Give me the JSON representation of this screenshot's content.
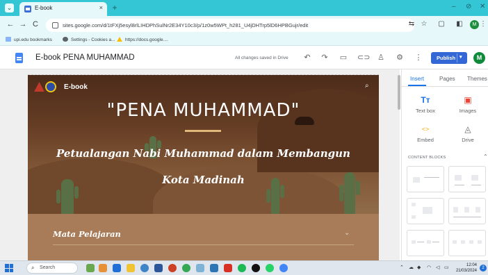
{
  "browser": {
    "tab_title": "E-book",
    "tab_close": "×",
    "new_tab": "+",
    "menu": "⌄",
    "window_controls": {
      "minimize": "–",
      "maximize": "⊘",
      "close": "✕"
    },
    "nav": {
      "back": "←",
      "forward": "→",
      "reload": "C"
    },
    "url": "sites.google.com/d/1tFXj5esyl8rlLIHDPhSulNr2E34Y10c3/p/1z0w5WPt_h281_U4jDHTrp5lD6HPBGujr/edit",
    "bookmarks": [
      {
        "label": "upi.edu bookmarks",
        "color": "#8ab4f8"
      },
      {
        "label": "Settings - Cookies a...",
        "color": "#5f6368"
      },
      {
        "label": "https://docs.google....",
        "color": "#fbbc04"
      }
    ],
    "profile_initial": "M"
  },
  "sites_header": {
    "title": "E-book PENA MUHAMMAD",
    "save_status": "All changes saved in Drive",
    "publish_label": "Publish",
    "avatar_initial": "M",
    "icons": [
      "undo-icon",
      "redo-icon",
      "preview-icon",
      "link-icon",
      "share-icon",
      "settings-icon",
      "more-icon"
    ]
  },
  "hero": {
    "site_name": "E-book",
    "title": "\"PENA MUHAMMAD\"",
    "subtitle_line1": "Petualangan Nabi Muhammad dalam Membangun",
    "subtitle_line2": "Kota Madinah"
  },
  "section": {
    "label": "Mata Pelajaran"
  },
  "panel": {
    "tabs": [
      "Insert",
      "Pages",
      "Themes"
    ],
    "active_tab": "Insert",
    "items": [
      {
        "label": "Text box",
        "icon": "Tт"
      },
      {
        "label": "Images",
        "icon": "▣"
      },
      {
        "label": "Embed",
        "icon": "<>"
      },
      {
        "label": "Drive",
        "icon": "◬"
      }
    ],
    "content_blocks_title": "CONTENT BLOCKS"
  },
  "taskbar": {
    "search_label": "Search",
    "time": "12:04",
    "date": "21/03/2024",
    "notifications": "2"
  },
  "colors": {
    "browser_accent": "#35c6d6",
    "publish_blue": "#3367d6",
    "hero_brown": "#7a4a2c",
    "section_tan": "#a87c58"
  }
}
